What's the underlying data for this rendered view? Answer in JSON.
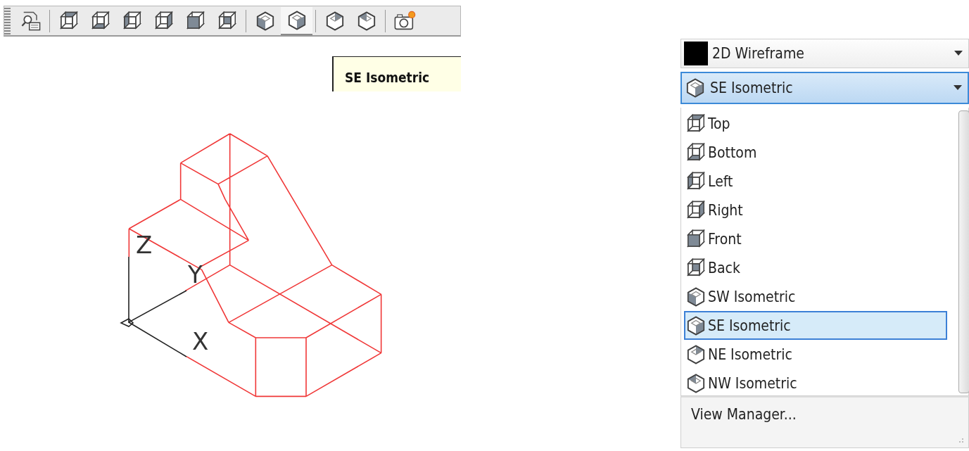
{
  "toolbar": {
    "groups": [
      [
        {
          "kind": "namedviews",
          "selected": false
        }
      ],
      [
        {
          "kind": "top",
          "selected": false
        },
        {
          "kind": "bottom",
          "selected": false
        },
        {
          "kind": "left",
          "selected": false
        },
        {
          "kind": "right",
          "selected": false
        },
        {
          "kind": "front",
          "selected": false
        },
        {
          "kind": "back",
          "selected": false
        }
      ],
      [
        {
          "kind": "southwest",
          "selected": false
        },
        {
          "kind": "southeast",
          "selected": true
        }
      ],
      [
        {
          "kind": "northeast",
          "selected": false
        },
        {
          "kind": "northwest",
          "selected": false
        }
      ],
      [
        {
          "kind": "camera",
          "selected": false
        }
      ]
    ]
  },
  "tooltip": {
    "text": "SE Isometric"
  },
  "drawing": {
    "axis_labels": [
      "Z",
      "Y",
      "X"
    ]
  },
  "visual_style_combo": {
    "value": "2D Wireframe"
  },
  "view_combo": {
    "value": "SE Isometric",
    "kind": "southeast",
    "expanded": true
  },
  "view_list": {
    "items": [
      {
        "label": "Top",
        "kind": "top",
        "selected": false
      },
      {
        "label": "Bottom",
        "kind": "bottom",
        "selected": false
      },
      {
        "label": "Left",
        "kind": "left",
        "selected": false
      },
      {
        "label": "Right",
        "kind": "right",
        "selected": false
      },
      {
        "label": "Front",
        "kind": "front",
        "selected": false
      },
      {
        "label": "Back",
        "kind": "back",
        "selected": false
      },
      {
        "label": "SW Isometric",
        "kind": "southwest",
        "selected": false
      },
      {
        "label": "SE Isometric",
        "kind": "southeast",
        "selected": true
      },
      {
        "label": "NE Isometric",
        "kind": "northeast",
        "selected": false
      },
      {
        "label": "NW Isometric",
        "kind": "northwest",
        "selected": false
      }
    ],
    "footer": "View Manager..."
  }
}
